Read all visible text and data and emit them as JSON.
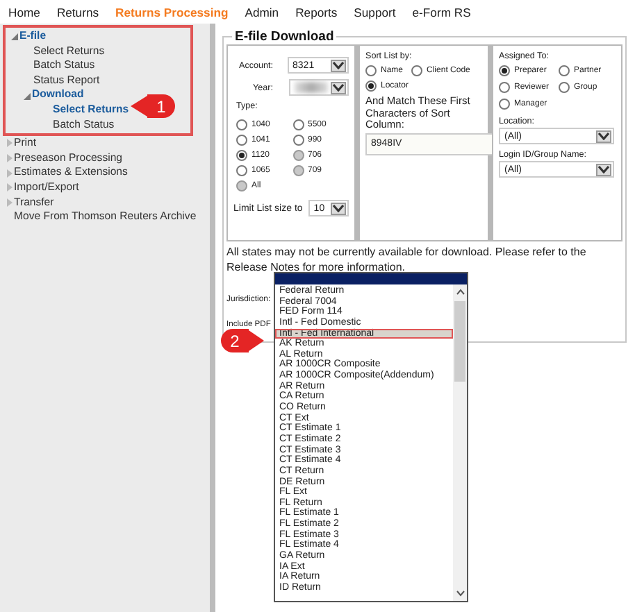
{
  "nav": [
    {
      "label": "Home",
      "selected": false
    },
    {
      "label": "Returns",
      "selected": false
    },
    {
      "label": "Returns Processing",
      "selected": true
    },
    {
      "label": "Admin",
      "selected": false
    },
    {
      "label": "Reports",
      "selected": false
    },
    {
      "label": "Support",
      "selected": false
    },
    {
      "label": "e-Form RS",
      "selected": false
    }
  ],
  "sidebar": {
    "items": [
      {
        "label": "E-file",
        "expanded": true,
        "children": [
          {
            "label": "Select Returns",
            "selected": false
          },
          {
            "label": "Batch Status",
            "selected": false
          },
          {
            "label": "Status Report",
            "selected": false
          },
          {
            "label": "Download",
            "expanded": true,
            "children": [
              {
                "label": "Select Returns",
                "selected": true
              },
              {
                "label": "Batch Status",
                "selected": false
              }
            ]
          }
        ]
      },
      {
        "label": "Print",
        "expanded": false,
        "selected": false
      },
      {
        "label": "Preseason Processing",
        "expanded": false,
        "selected": false
      },
      {
        "label": "Estimates & Extensions",
        "expanded": false,
        "selected": false
      },
      {
        "label": "Import/Export",
        "expanded": false,
        "selected": false
      },
      {
        "label": "Transfer",
        "expanded": false,
        "selected": false
      },
      {
        "label": "Move From Thomson Reuters Archive",
        "selected": false
      }
    ]
  },
  "callouts": [
    "1",
    "2"
  ],
  "panel": {
    "title": "E-file Download",
    "account": {
      "label": "Account:",
      "value": "8321"
    },
    "year": {
      "label": "Year:"
    },
    "type": {
      "label": "Type:",
      "options": [
        {
          "label": "1040",
          "checked": false,
          "disabled": false
        },
        {
          "label": "5500",
          "checked": false,
          "disabled": false
        },
        {
          "label": "1041",
          "checked": false,
          "disabled": false
        },
        {
          "label": "990",
          "checked": false,
          "disabled": false
        },
        {
          "label": "1120",
          "checked": true,
          "disabled": false
        },
        {
          "label": "706",
          "checked": false,
          "disabled": true
        },
        {
          "label": "1065",
          "checked": false,
          "disabled": false
        },
        {
          "label": "709",
          "checked": false,
          "disabled": true
        },
        {
          "label": "All",
          "checked": false,
          "disabled": true
        }
      ]
    },
    "limit": {
      "label": "Limit List size to",
      "value": "10"
    },
    "sort": {
      "label": "Sort List by:",
      "options": [
        {
          "label": "Name",
          "checked": false
        },
        {
          "label": "Client Code",
          "checked": false
        },
        {
          "label": "Locator",
          "checked": true
        }
      ],
      "match_label": "And Match These First Characters of Sort Column:",
      "match_value": "8948IV"
    },
    "assigned": {
      "label": "Assigned To:",
      "options": [
        {
          "label": "Preparer",
          "checked": true
        },
        {
          "label": "Partner",
          "checked": false
        },
        {
          "label": "Reviewer",
          "checked": false
        },
        {
          "label": "Group",
          "checked": false
        },
        {
          "label": "Manager",
          "checked": false
        }
      ]
    },
    "location": {
      "label": "Location:",
      "value": "(All)"
    },
    "login": {
      "label": "Login ID/Group Name:",
      "value": "(All)"
    },
    "notice": "All states may not be currently available for download. Please refer to the Release Notes for more information.",
    "jurisdiction": {
      "label": "Jurisdiction:",
      "options": [
        {
          "label": "Federal Return",
          "selected": false
        },
        {
          "label": "Federal 7004",
          "selected": false
        },
        {
          "label": "FED Form 114",
          "selected": false
        },
        {
          "label": "Intl - Fed Domestic",
          "selected": false
        },
        {
          "label": "Intl - Fed International",
          "selected": true
        },
        {
          "label": "AK Return",
          "selected": false
        },
        {
          "label": "AL Return",
          "selected": false
        },
        {
          "label": "AR 1000CR Composite",
          "selected": false
        },
        {
          "label": "AR 1000CR Composite(Addendum)",
          "selected": false
        },
        {
          "label": "AR Return",
          "selected": false
        },
        {
          "label": "CA Return",
          "selected": false
        },
        {
          "label": "CO Return",
          "selected": false
        },
        {
          "label": "CT Ext",
          "selected": false
        },
        {
          "label": "CT Estimate 1",
          "selected": false
        },
        {
          "label": "CT Estimate 2",
          "selected": false
        },
        {
          "label": "CT Estimate 3",
          "selected": false
        },
        {
          "label": "CT Estimate 4",
          "selected": false
        },
        {
          "label": "CT Return",
          "selected": false
        },
        {
          "label": "DE Return",
          "selected": false
        },
        {
          "label": "FL Ext",
          "selected": false
        },
        {
          "label": "FL Return",
          "selected": false
        },
        {
          "label": "FL Estimate 1",
          "selected": false
        },
        {
          "label": "FL Estimate 2",
          "selected": false
        },
        {
          "label": "FL Estimate 3",
          "selected": false
        },
        {
          "label": "FL Estimate 4",
          "selected": false
        },
        {
          "label": "GA Return",
          "selected": false
        },
        {
          "label": "IA Ext",
          "selected": false
        },
        {
          "label": "IA Return",
          "selected": false
        },
        {
          "label": "ID Return",
          "selected": false
        }
      ]
    },
    "pdf_label": "Include PDF"
  }
}
